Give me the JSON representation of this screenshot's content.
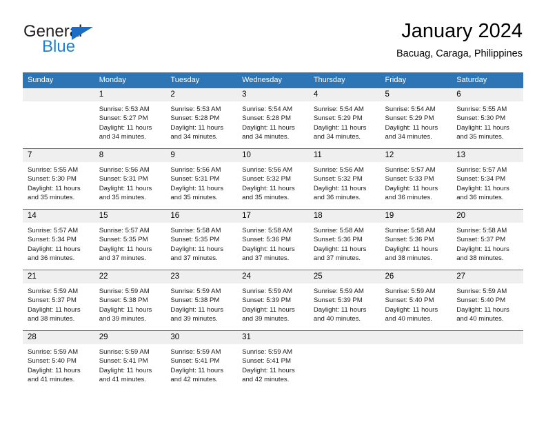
{
  "brand": {
    "name_part1": "General",
    "name_part2": "Blue",
    "logo_icon": "triangle-icon"
  },
  "header": {
    "title": "January 2024",
    "subtitle": "Bacuag, Caraga, Philippines"
  },
  "colors": {
    "header_blue": "#2e75b6",
    "brand_blue": "#1b7fd4",
    "daynum_band": "#efefef",
    "text": "#000000"
  },
  "calendar": {
    "weekday_headers": [
      "Sunday",
      "Monday",
      "Tuesday",
      "Wednesday",
      "Thursday",
      "Friday",
      "Saturday"
    ],
    "labels": {
      "sunrise": "Sunrise:",
      "sunset": "Sunset:",
      "daylight": "Daylight:"
    },
    "weeks": [
      [
        {
          "day": "",
          "sunrise": "",
          "sunset": "",
          "daylight_line1": "",
          "daylight_line2": ""
        },
        {
          "day": "1",
          "sunrise": "Sunrise: 5:53 AM",
          "sunset": "Sunset: 5:27 PM",
          "daylight_line1": "Daylight: 11 hours",
          "daylight_line2": "and 34 minutes."
        },
        {
          "day": "2",
          "sunrise": "Sunrise: 5:53 AM",
          "sunset": "Sunset: 5:28 PM",
          "daylight_line1": "Daylight: 11 hours",
          "daylight_line2": "and 34 minutes."
        },
        {
          "day": "3",
          "sunrise": "Sunrise: 5:54 AM",
          "sunset": "Sunset: 5:28 PM",
          "daylight_line1": "Daylight: 11 hours",
          "daylight_line2": "and 34 minutes."
        },
        {
          "day": "4",
          "sunrise": "Sunrise: 5:54 AM",
          "sunset": "Sunset: 5:29 PM",
          "daylight_line1": "Daylight: 11 hours",
          "daylight_line2": "and 34 minutes."
        },
        {
          "day": "5",
          "sunrise": "Sunrise: 5:54 AM",
          "sunset": "Sunset: 5:29 PM",
          "daylight_line1": "Daylight: 11 hours",
          "daylight_line2": "and 34 minutes."
        },
        {
          "day": "6",
          "sunrise": "Sunrise: 5:55 AM",
          "sunset": "Sunset: 5:30 PM",
          "daylight_line1": "Daylight: 11 hours",
          "daylight_line2": "and 35 minutes."
        }
      ],
      [
        {
          "day": "7",
          "sunrise": "Sunrise: 5:55 AM",
          "sunset": "Sunset: 5:30 PM",
          "daylight_line1": "Daylight: 11 hours",
          "daylight_line2": "and 35 minutes."
        },
        {
          "day": "8",
          "sunrise": "Sunrise: 5:56 AM",
          "sunset": "Sunset: 5:31 PM",
          "daylight_line1": "Daylight: 11 hours",
          "daylight_line2": "and 35 minutes."
        },
        {
          "day": "9",
          "sunrise": "Sunrise: 5:56 AM",
          "sunset": "Sunset: 5:31 PM",
          "daylight_line1": "Daylight: 11 hours",
          "daylight_line2": "and 35 minutes."
        },
        {
          "day": "10",
          "sunrise": "Sunrise: 5:56 AM",
          "sunset": "Sunset: 5:32 PM",
          "daylight_line1": "Daylight: 11 hours",
          "daylight_line2": "and 35 minutes."
        },
        {
          "day": "11",
          "sunrise": "Sunrise: 5:56 AM",
          "sunset": "Sunset: 5:32 PM",
          "daylight_line1": "Daylight: 11 hours",
          "daylight_line2": "and 36 minutes."
        },
        {
          "day": "12",
          "sunrise": "Sunrise: 5:57 AM",
          "sunset": "Sunset: 5:33 PM",
          "daylight_line1": "Daylight: 11 hours",
          "daylight_line2": "and 36 minutes."
        },
        {
          "day": "13",
          "sunrise": "Sunrise: 5:57 AM",
          "sunset": "Sunset: 5:34 PM",
          "daylight_line1": "Daylight: 11 hours",
          "daylight_line2": "and 36 minutes."
        }
      ],
      [
        {
          "day": "14",
          "sunrise": "Sunrise: 5:57 AM",
          "sunset": "Sunset: 5:34 PM",
          "daylight_line1": "Daylight: 11 hours",
          "daylight_line2": "and 36 minutes."
        },
        {
          "day": "15",
          "sunrise": "Sunrise: 5:57 AM",
          "sunset": "Sunset: 5:35 PM",
          "daylight_line1": "Daylight: 11 hours",
          "daylight_line2": "and 37 minutes."
        },
        {
          "day": "16",
          "sunrise": "Sunrise: 5:58 AM",
          "sunset": "Sunset: 5:35 PM",
          "daylight_line1": "Daylight: 11 hours",
          "daylight_line2": "and 37 minutes."
        },
        {
          "day": "17",
          "sunrise": "Sunrise: 5:58 AM",
          "sunset": "Sunset: 5:36 PM",
          "daylight_line1": "Daylight: 11 hours",
          "daylight_line2": "and 37 minutes."
        },
        {
          "day": "18",
          "sunrise": "Sunrise: 5:58 AM",
          "sunset": "Sunset: 5:36 PM",
          "daylight_line1": "Daylight: 11 hours",
          "daylight_line2": "and 37 minutes."
        },
        {
          "day": "19",
          "sunrise": "Sunrise: 5:58 AM",
          "sunset": "Sunset: 5:36 PM",
          "daylight_line1": "Daylight: 11 hours",
          "daylight_line2": "and 38 minutes."
        },
        {
          "day": "20",
          "sunrise": "Sunrise: 5:58 AM",
          "sunset": "Sunset: 5:37 PM",
          "daylight_line1": "Daylight: 11 hours",
          "daylight_line2": "and 38 minutes."
        }
      ],
      [
        {
          "day": "21",
          "sunrise": "Sunrise: 5:59 AM",
          "sunset": "Sunset: 5:37 PM",
          "daylight_line1": "Daylight: 11 hours",
          "daylight_line2": "and 38 minutes."
        },
        {
          "day": "22",
          "sunrise": "Sunrise: 5:59 AM",
          "sunset": "Sunset: 5:38 PM",
          "daylight_line1": "Daylight: 11 hours",
          "daylight_line2": "and 39 minutes."
        },
        {
          "day": "23",
          "sunrise": "Sunrise: 5:59 AM",
          "sunset": "Sunset: 5:38 PM",
          "daylight_line1": "Daylight: 11 hours",
          "daylight_line2": "and 39 minutes."
        },
        {
          "day": "24",
          "sunrise": "Sunrise: 5:59 AM",
          "sunset": "Sunset: 5:39 PM",
          "daylight_line1": "Daylight: 11 hours",
          "daylight_line2": "and 39 minutes."
        },
        {
          "day": "25",
          "sunrise": "Sunrise: 5:59 AM",
          "sunset": "Sunset: 5:39 PM",
          "daylight_line1": "Daylight: 11 hours",
          "daylight_line2": "and 40 minutes."
        },
        {
          "day": "26",
          "sunrise": "Sunrise: 5:59 AM",
          "sunset": "Sunset: 5:40 PM",
          "daylight_line1": "Daylight: 11 hours",
          "daylight_line2": "and 40 minutes."
        },
        {
          "day": "27",
          "sunrise": "Sunrise: 5:59 AM",
          "sunset": "Sunset: 5:40 PM",
          "daylight_line1": "Daylight: 11 hours",
          "daylight_line2": "and 40 minutes."
        }
      ],
      [
        {
          "day": "28",
          "sunrise": "Sunrise: 5:59 AM",
          "sunset": "Sunset: 5:40 PM",
          "daylight_line1": "Daylight: 11 hours",
          "daylight_line2": "and 41 minutes."
        },
        {
          "day": "29",
          "sunrise": "Sunrise: 5:59 AM",
          "sunset": "Sunset: 5:41 PM",
          "daylight_line1": "Daylight: 11 hours",
          "daylight_line2": "and 41 minutes."
        },
        {
          "day": "30",
          "sunrise": "Sunrise: 5:59 AM",
          "sunset": "Sunset: 5:41 PM",
          "daylight_line1": "Daylight: 11 hours",
          "daylight_line2": "and 42 minutes."
        },
        {
          "day": "31",
          "sunrise": "Sunrise: 5:59 AM",
          "sunset": "Sunset: 5:41 PM",
          "daylight_line1": "Daylight: 11 hours",
          "daylight_line2": "and 42 minutes."
        },
        {
          "day": "",
          "sunrise": "",
          "sunset": "",
          "daylight_line1": "",
          "daylight_line2": ""
        },
        {
          "day": "",
          "sunrise": "",
          "sunset": "",
          "daylight_line1": "",
          "daylight_line2": ""
        },
        {
          "day": "",
          "sunrise": "",
          "sunset": "",
          "daylight_line1": "",
          "daylight_line2": ""
        }
      ]
    ]
  }
}
